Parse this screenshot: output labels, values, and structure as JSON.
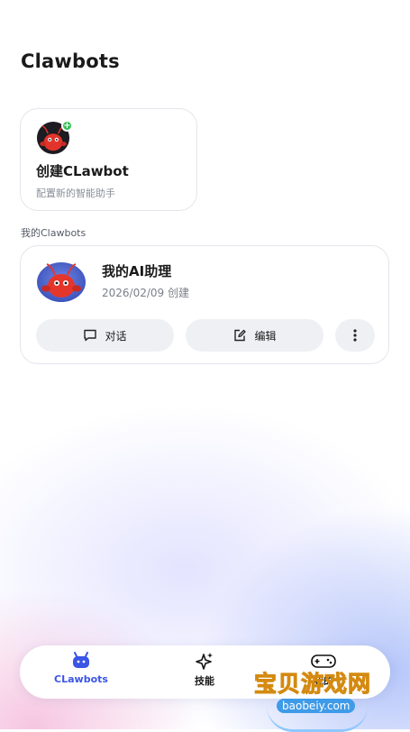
{
  "page": {
    "title": "Clawbots"
  },
  "create_card": {
    "title": "创建CLawbot",
    "subtitle": "配置新的智能助手"
  },
  "section": {
    "label": "我的Clawbots"
  },
  "bots": [
    {
      "name": "我的AI助理",
      "created": "2026/02/09 创建",
      "actions": {
        "chat_label": "对话",
        "edit_label": "编辑"
      }
    }
  ],
  "tabbar": {
    "tabs": [
      {
        "label": "CLawbots",
        "icon": "robot-icon",
        "active": true
      },
      {
        "label": "技能",
        "icon": "sparkle-icon",
        "active": false
      },
      {
        "label": "我的",
        "icon": "gamepad-icon",
        "active": false
      }
    ],
    "active_color": "#3b55e6"
  },
  "watermark": {
    "text": "宝贝游戏网",
    "url": "baobeiy.com"
  }
}
